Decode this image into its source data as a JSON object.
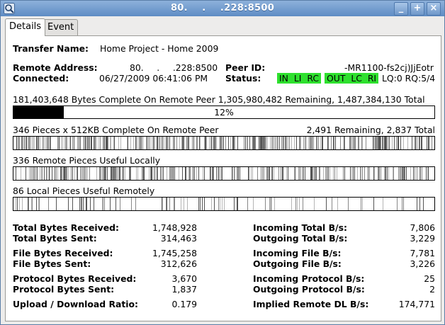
{
  "window": {
    "title": "80.   .   .228:8500",
    "controls": [
      "_",
      "+",
      "×"
    ]
  },
  "tabs": [
    {
      "label": "Details",
      "active": true
    },
    {
      "label": "Event Log",
      "active": false
    }
  ],
  "transfer": {
    "name_label": "Transfer Name:",
    "name_value": "Home Project - Home 2009"
  },
  "remote": {
    "address_label": "Remote Address:",
    "address_value": "80.   .   .228:8500",
    "connected_label": "Connected:",
    "connected_value": "06/27/2009 06:41:06 PM",
    "peer_label": "Peer ID:",
    "peer_value": "-MR1100-fs2cj)JjEotr",
    "status_label": "Status:",
    "status_in": "IN LI RC",
    "status_out": "OUT LC RI",
    "status_queue": "LQ:0 RQ:5/4",
    "status_color": "#2ee02e"
  },
  "progress": {
    "bytes_line": "181,403,648 Bytes Complete On Remote Peer  1,305,980,482 Remaining,  1,487,384,130 Total",
    "percent": 0.12,
    "percent_label": "12%"
  },
  "pieces": {
    "complete_left": "346 Pieces  x  512KB Complete On Remote Peer",
    "complete_right": "2,491 Remaining,  2,837 Total",
    "useful_locally": "336 Remote Pieces Useful Locally",
    "useful_remotely": "86 Local Pieces Useful Remotely"
  },
  "stats_left": [
    {
      "label": "Total Bytes Received:",
      "value": "1,748,928"
    },
    {
      "label": "Total Bytes Sent:",
      "value": "314,463"
    },
    {
      "label": "File Bytes Received:",
      "value": "1,745,258"
    },
    {
      "label": "File Bytes Sent:",
      "value": "312,626"
    },
    {
      "label": "Protocol Bytes Received:",
      "value": "3,670"
    },
    {
      "label": "Protocol Bytes Sent:",
      "value": "1,837"
    },
    {
      "label": "Upload / Download Ratio:",
      "value": "0.179"
    }
  ],
  "stats_right": [
    {
      "label": "Incoming Total B/s:",
      "value": "7,806"
    },
    {
      "label": "Outgoing Total B/s:",
      "value": "3,229"
    },
    {
      "label": "Incoming File B/s:",
      "value": "7,781"
    },
    {
      "label": "Outgoing File B/s:",
      "value": "3,226"
    },
    {
      "label": "Incoming Protocol B/s:",
      "value": "25"
    },
    {
      "label": "Outgoing Protocol B/s:",
      "value": "2"
    },
    {
      "label": "Implied Remote DL B/s:",
      "value": "174,771"
    }
  ]
}
